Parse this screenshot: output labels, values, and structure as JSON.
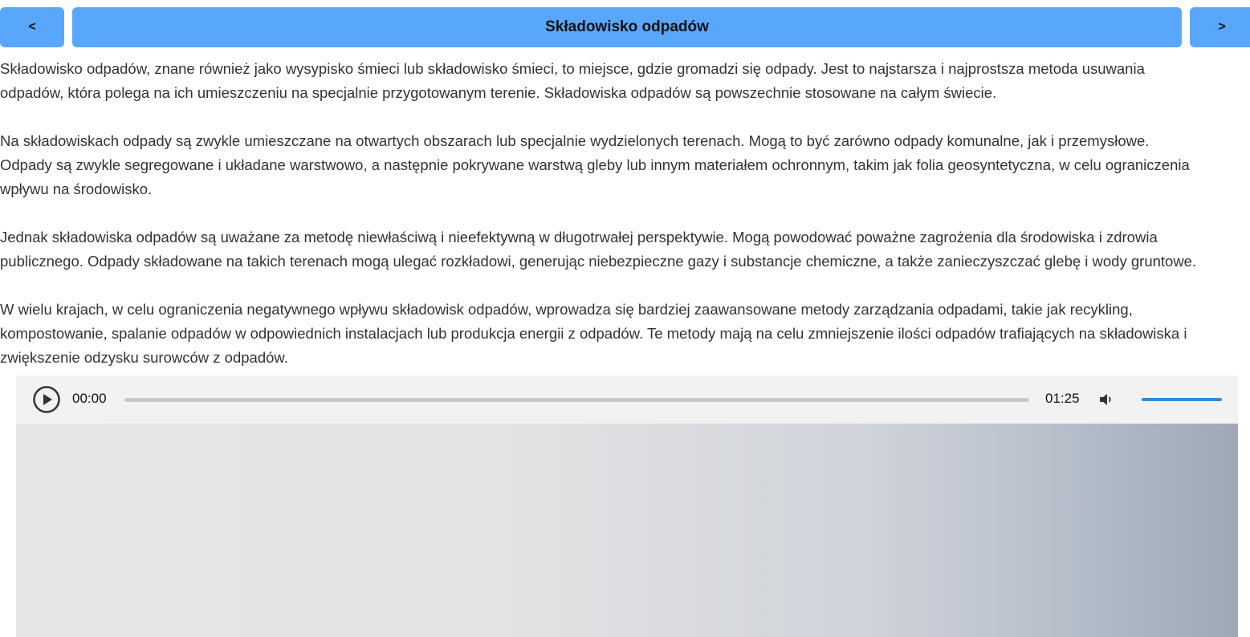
{
  "nav": {
    "prev_label": "<",
    "title": "Składowisko odpadów",
    "next_label": ">"
  },
  "content": {
    "paragraphs": [
      {
        "lines": [
          "Składowisko odpadów, znane również jako wysypisko śmieci lub składowisko śmieci, to miejsce, gdzie gromadzi się odpady. Jest to najstarsza i najprostsza metoda usuwania",
          "odpadów, która polega na ich umieszczeniu na specjalnie przygotowanym terenie. Składowiska odpadów są powszechnie stosowane na całym świecie."
        ]
      },
      {
        "lines": [
          "Na składowiskach odpady są zwykle umieszczane na otwartych obszarach lub specjalnie wydzielonych terenach. Mogą to być zarówno odpady komunalne, jak i przemysłowe.",
          "Odpady są zwykle segregowane i układane warstwowo, a następnie pokrywane warstwą gleby lub innym materiałem ochronnym, takim jak folia geosyntetyczna, w celu ograniczenia",
          "wpływu na środowisko."
        ]
      },
      {
        "lines": [
          "Jednak składowiska odpadów są uważane za metodę niewłaściwą i nieefektywną w długotrwałej perspektywie. Mogą powodować poważne zagrożenia dla środowiska i zdrowia",
          "publicznego. Odpady składowane na takich terenach mogą ulegać rozkładowi, generując niebezpieczne gazy i substancje chemiczne, a także zanieczyszczać glebę i wody gruntowe."
        ]
      },
      {
        "lines": [
          "W wielu krajach, w celu ograniczenia negatywnego wpływu składowisk odpadów, wprowadza się bardziej zaawansowane metody zarządzania odpadami, takie jak recykling,",
          "kompostowanie, spalanie odpadów w odpowiednich instalacjach lub produkcja energii z odpadów. Te metody mają na celu zmniejszenie ilości odpadów trafiających na składowiska i",
          "zwiększenie odzysku surowców z odpadów."
        ]
      }
    ]
  },
  "player": {
    "current_time": "00:00",
    "duration": "01:25",
    "progress": 0,
    "volume": 1.0,
    "play_icon": "play-icon",
    "volume_icon": "volume-icon",
    "accent_color": "#2d8ddb"
  },
  "colors": {
    "nav_button": "#58a7fb",
    "player_bg": "#f2f2f2"
  }
}
